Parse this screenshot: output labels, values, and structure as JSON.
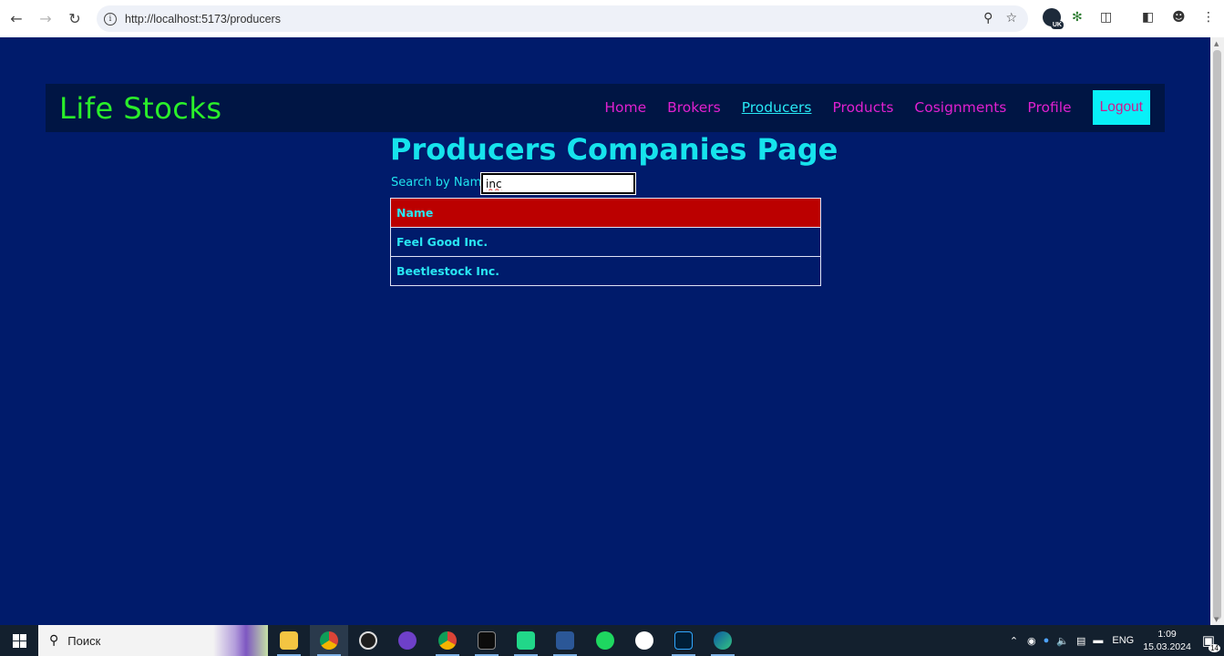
{
  "browser": {
    "url": "http://localhost:5173/producers",
    "extension_badge": "UK"
  },
  "app": {
    "brand": "Life Stocks",
    "nav": [
      {
        "label": "Home",
        "active": false
      },
      {
        "label": "Brokers",
        "active": false
      },
      {
        "label": "Producers",
        "active": true
      },
      {
        "label": "Products",
        "active": false
      },
      {
        "label": "Cosignments",
        "active": false
      },
      {
        "label": "Profile",
        "active": false
      }
    ],
    "logout_label": "Logout"
  },
  "main": {
    "title": "Producers Companies Page",
    "search_label": "Search by Name:",
    "search_value": "inc",
    "table": {
      "headers": [
        "Name"
      ],
      "rows": [
        [
          "Feel Good Inc."
        ],
        [
          "Beetlestock Inc."
        ]
      ]
    }
  },
  "taskbar": {
    "search_placeholder": "Поиск",
    "language": "ENG",
    "time": "1:09",
    "date": "15.03.2024",
    "notification_count": "14"
  },
  "colors": {
    "page_bg": "#001b6b",
    "nav_bg": "#001544",
    "brand": "#2aef2a",
    "nav_link": "#e020d0",
    "nav_active": "#27e8f5",
    "logout_bg": "#08f0f8",
    "table_header_bg": "#bb0000",
    "text_cyan": "#29e6f2"
  }
}
